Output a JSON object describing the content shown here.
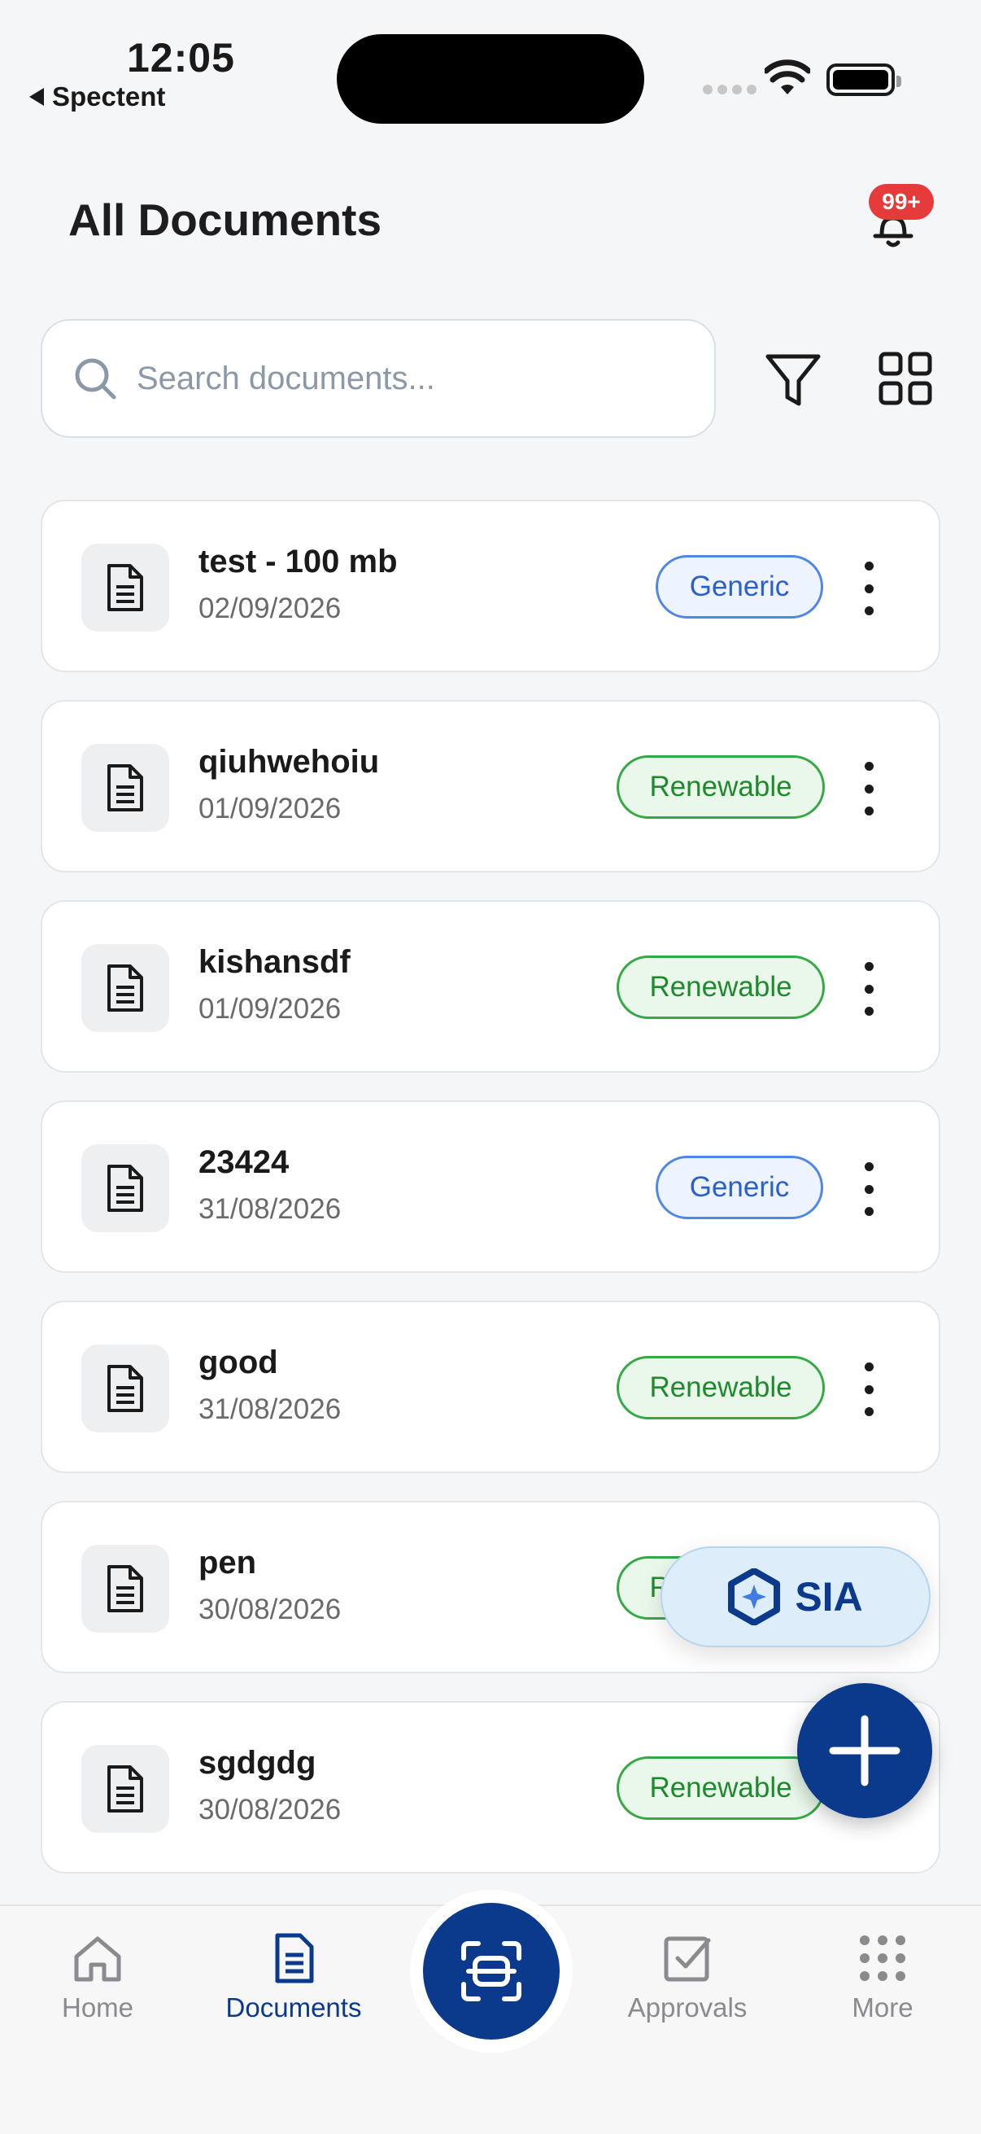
{
  "status_bar": {
    "time": "12:05",
    "back_app": "Spectent"
  },
  "header": {
    "title": "All Documents",
    "notification_count": "99+"
  },
  "search": {
    "placeholder": "Search documents..."
  },
  "documents": [
    {
      "name": "test - 100 mb",
      "date": "02/09/2026",
      "tag": "Generic"
    },
    {
      "name": "qiuhwehoiu",
      "date": "01/09/2026",
      "tag": "Renewable"
    },
    {
      "name": "kishansdf",
      "date": "01/09/2026",
      "tag": "Renewable"
    },
    {
      "name": "23424",
      "date": "31/08/2026",
      "tag": "Generic"
    },
    {
      "name": "good",
      "date": "31/08/2026",
      "tag": "Renewable"
    },
    {
      "name": "pen",
      "date": "30/08/2026",
      "tag": "Renewable"
    },
    {
      "name": "sgdgdg",
      "date": "30/08/2026",
      "tag": "Renewable"
    }
  ],
  "sia": {
    "label": "SIA"
  },
  "nav": {
    "home": "Home",
    "documents": "Documents",
    "approvals": "Approvals",
    "more": "More"
  },
  "colors": {
    "primary": "#0b3a8c",
    "badge": "#e53b3b",
    "generic": "#4f86e8",
    "renewable": "#35a944"
  }
}
